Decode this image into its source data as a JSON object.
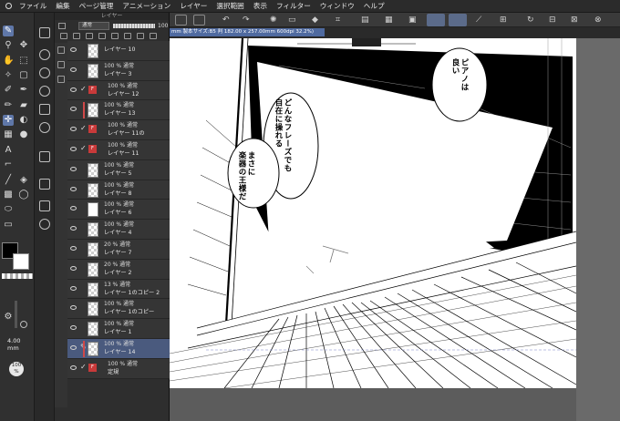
{
  "menubar": {
    "items": [
      "ファイル",
      "編集",
      "ページ管理",
      "アニメーション",
      "レイヤー",
      "選択範囲",
      "表示",
      "フィルター",
      "ウィンドウ",
      "ヘルプ"
    ]
  },
  "tool_icons": [
    "pen-icon",
    "zoom-icon",
    "move-icon",
    "select-icon",
    "wand-icon",
    "eyedropper-icon",
    "pen-nib-icon",
    "eraser-icon",
    "crosshair-icon",
    "fill-icon",
    "frame-icon",
    "text-icon",
    "ruler-icon",
    "bucket-icon",
    "gradient-icon",
    "lasso-icon",
    "shape-icon",
    "figure-icon"
  ],
  "color": {
    "foreground": "#000000",
    "background": "#ffffff"
  },
  "tool_property": {
    "brush_size": "4.00",
    "brush_size_unit": "mm",
    "opacity": "100",
    "opacity_unit": "%"
  },
  "layer_panel": {
    "title": "レイヤー",
    "blend_mode": "通常",
    "opacity": "100",
    "layers": [
      {
        "mode": "",
        "name": "レイヤー 10",
        "kind": "plain"
      },
      {
        "mode": "100 % 通常",
        "name": "レイヤー 3",
        "kind": "plain"
      },
      {
        "mode": "100 % 通常",
        "name": "レイヤー 12",
        "kind": "vector"
      },
      {
        "mode": "100 % 通常",
        "name": "レイヤー 13",
        "kind": "plain"
      },
      {
        "mode": "100 % 通常",
        "name": "レイヤー 11の",
        "kind": "vector"
      },
      {
        "mode": "100 % 通常",
        "name": "レイヤー 11",
        "kind": "vector"
      },
      {
        "mode": "100 % 通常",
        "name": "レイヤー 5",
        "kind": "plain"
      },
      {
        "mode": "100 % 通常",
        "name": "レイヤー 8",
        "kind": "plain"
      },
      {
        "mode": "100 % 通常",
        "name": "レイヤー 6",
        "kind": "image"
      },
      {
        "mode": "100 % 通常",
        "name": "レイヤー 4",
        "kind": "plain"
      },
      {
        "mode": "20 % 通常",
        "name": "レイヤー 7",
        "kind": "plain"
      },
      {
        "mode": "20 % 通常",
        "name": "レイヤー 2",
        "kind": "plain"
      },
      {
        "mode": "13 % 通常",
        "name": "レイヤー 1のコピー 2",
        "kind": "plain"
      },
      {
        "mode": "100 % 通常",
        "name": "レイヤー 1のコピー",
        "kind": "plain"
      },
      {
        "mode": "100 % 通常",
        "name": "レイヤー 1",
        "kind": "plain"
      },
      {
        "mode": "100 % 通常",
        "name": "レイヤー 14",
        "kind": "active"
      },
      {
        "mode": "100 % 通常",
        "name": "定規",
        "kind": "vector"
      }
    ]
  },
  "canvas": {
    "info": "mm 製本サイズ:B5 判 182.00 x 257.00mm 600dpi 32.2%)",
    "balloons": {
      "b1": "ピアノは\n良い",
      "b2": "どんなフレーズでも\n自在に操れる",
      "b3": "まさに\n楽器の王様だ"
    }
  }
}
